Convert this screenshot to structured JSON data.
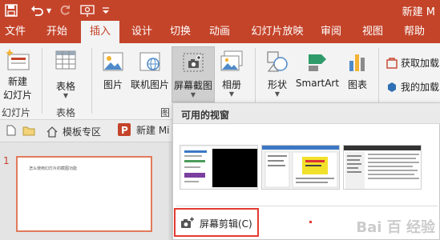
{
  "colors": {
    "accent": "#c4442a",
    "highlight_box": "#e23b32"
  },
  "titlebar": {
    "doc_title": "新建 M",
    "icons": [
      "save-icon",
      "undo-icon",
      "undo-dropdown-icon",
      "redo-icon",
      "presenter-icon",
      "customize-dropdown-icon"
    ]
  },
  "tabs": [
    "文件",
    "开始",
    "插入",
    "设计",
    "切换",
    "动画",
    "幻灯片放映",
    "审阅",
    "视图",
    "帮助"
  ],
  "active_tab": "插入",
  "ribbon": {
    "new_slide_line1": "新建",
    "new_slide_line2": "幻灯片",
    "table": "表格",
    "picture": "图片",
    "online_picture": "联机图片",
    "screenshot": "屏幕截图",
    "album": "相册",
    "shapes": "形状",
    "smartart": "SmartArt",
    "chart": "图表",
    "get_addins": "获取加载",
    "my_addins": "我的加载",
    "groups": {
      "slides": "幻灯片",
      "tables": "表格",
      "images": "图"
    }
  },
  "subbar": {
    "template": "模板专区",
    "doc_tab": "新建 Mi"
  },
  "slides": {
    "number": "1",
    "thumb_text": "怎么使用幻灯片的截图功能"
  },
  "dropdown": {
    "header": "可用的视窗",
    "clip_label": "屏幕剪辑(C)"
  },
  "watermark": "Bai 百 经验"
}
